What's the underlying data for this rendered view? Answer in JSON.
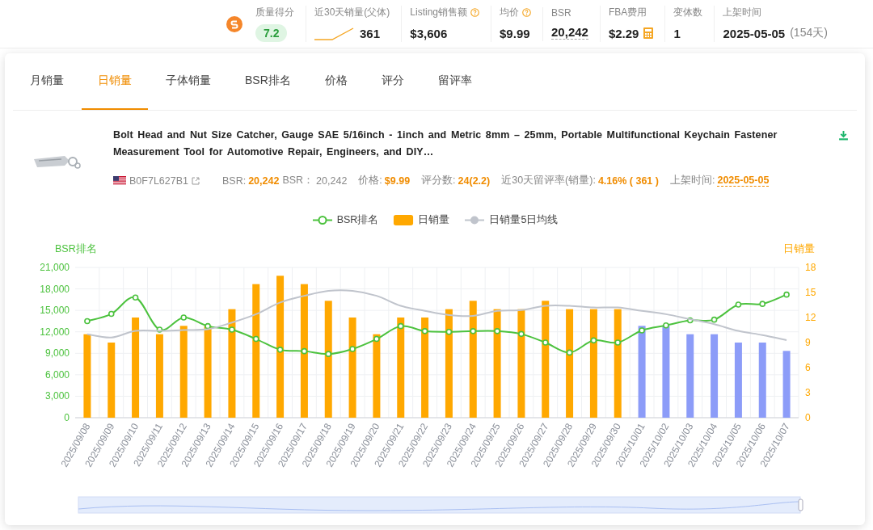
{
  "stats_bar": [
    {
      "kind": "score",
      "label": "质量得分",
      "value": "7.2"
    },
    {
      "kind": "trend",
      "label": "近30天销量(父体)",
      "value": "361"
    },
    {
      "kind": "plain",
      "label": "Listing销售额",
      "value": "$3,606",
      "help": true
    },
    {
      "kind": "plain",
      "label": "均价",
      "value": "$9.99",
      "help": true
    },
    {
      "kind": "underlined",
      "label": "BSR",
      "value": "20,242"
    },
    {
      "kind": "calculator",
      "label": "FBA费用",
      "value": "$2.29"
    },
    {
      "kind": "plain",
      "label": "变体数",
      "value": "1"
    },
    {
      "kind": "date",
      "label": "上架时间",
      "value": "2025-05-05",
      "note": "(154天)"
    }
  ],
  "tabs": [
    {
      "label": "月销量",
      "selected": false
    },
    {
      "label": "日销量",
      "selected": true
    },
    {
      "label": "子体销量",
      "selected": false
    },
    {
      "label": "BSR排名",
      "selected": false
    },
    {
      "label": "价格",
      "selected": false
    },
    {
      "label": "评分",
      "selected": false
    },
    {
      "label": "留评率",
      "selected": false
    }
  ],
  "product": {
    "title": "Bolt Head and Nut Size Catcher, Gauge SAE 5/16inch - 1inch and Metric 8mm – 25mm, Portable Multifunctional Keychain Fastener Measurement Tool for Automotive Repair, Engineers, and DIY…",
    "asin": "B0F7L627B1",
    "facts": [
      {
        "label": "BSR:",
        "value": "20,242",
        "highlighted": true,
        "underlined": false
      },
      {
        "label": "BSR：",
        "value": "20,242",
        "highlighted": false,
        "underlined": false
      },
      {
        "label": "价格:",
        "value": "$9.99",
        "highlighted": true,
        "underlined": false
      },
      {
        "label": "评分数:",
        "value": "24(2.2)",
        "highlighted": true,
        "underlined": false
      },
      {
        "label": "近30天留评率(销量):",
        "value": "4.16% ( 361 )",
        "highlighted": true,
        "underlined": false
      },
      {
        "label": "上架时间:",
        "value": "2025-05-05",
        "highlighted": true,
        "underlined": true
      }
    ]
  },
  "chart_data": {
    "type": "bar",
    "stacked": true,
    "grid": true,
    "ylabel": "BSR排名",
    "y2label": "日销量",
    "ylim": [
      0,
      21000
    ],
    "y2lim": [
      0,
      18
    ],
    "yticks": [
      {
        "value": 0,
        "label": "0"
      },
      {
        "value": 3000,
        "label": "3,000"
      },
      {
        "value": 6000,
        "label": "6,000"
      },
      {
        "value": 9000,
        "label": "9,000"
      },
      {
        "value": 12000,
        "label": "12,000"
      },
      {
        "value": 15000,
        "label": "15,000"
      },
      {
        "value": 18000,
        "label": "18,000"
      },
      {
        "value": 21000,
        "label": "21,000"
      }
    ],
    "y2ticks": [
      0,
      3,
      6,
      9,
      12,
      15,
      18
    ],
    "categories": [
      "2025/09/08",
      "2025/09/09",
      "2025/09/10",
      "2025/09/11",
      "2025/09/12",
      "2025/09/13",
      "2025/09/14",
      "2025/09/15",
      "2025/09/16",
      "2025/09/17",
      "2025/09/18",
      "2025/09/19",
      "2025/09/20",
      "2025/09/21",
      "2025/09/22",
      "2025/09/23",
      "2025/09/24",
      "2025/09/25",
      "2025/09/26",
      "2025/09/27",
      "2025/09/28",
      "2025/09/29",
      "2025/09/30",
      "2025/10/01",
      "2025/10/02",
      "2025/10/03",
      "2025/10/04",
      "2025/10/05",
      "2025/10/06",
      "2025/10/07"
    ],
    "series": [
      {
        "name": "BSR排名",
        "type": "line",
        "marker": "circle",
        "color": "#4cc23e",
        "values": [
          13500,
          14500,
          16800,
          12300,
          14000,
          12800,
          12300,
          11000,
          9500,
          9300,
          8900,
          9600,
          11000,
          12800,
          12100,
          12000,
          12100,
          12100,
          11700,
          10500,
          9100,
          10800,
          10500,
          12200,
          12900,
          13600,
          13700,
          15800,
          15900,
          17200
        ]
      },
      {
        "name": "日销量",
        "type": "bar",
        "axis": "y2",
        "color": "#ffa800",
        "values": [
          10,
          9,
          12,
          10,
          11,
          11,
          13,
          16,
          17,
          16,
          14,
          12,
          10,
          12,
          12,
          13,
          14,
          13,
          13,
          14,
          13,
          13,
          13,
          null,
          null,
          null,
          null,
          null,
          null,
          null
        ]
      },
      {
        "type": "bar",
        "axis": "y2",
        "color": "#8c9cf8",
        "values": [
          null,
          null,
          null,
          null,
          null,
          null,
          null,
          null,
          null,
          null,
          null,
          null,
          null,
          null,
          null,
          null,
          null,
          null,
          null,
          null,
          null,
          null,
          null,
          11,
          11,
          10,
          10,
          9,
          9,
          8
        ]
      },
      {
        "name": "日销量5日均线",
        "type": "line",
        "axis": "y2",
        "color": "#c0c4cc",
        "values": [
          10,
          9.6,
          10.4,
          10.4,
          10.5,
          10.6,
          11.4,
          12.4,
          13.8,
          14.6,
          15.2,
          15.2,
          14.6,
          13.4,
          12.8,
          12.3,
          12.2,
          12.8,
          12.9,
          13.4,
          13.4,
          13.2,
          13.2,
          12.8,
          12.4,
          11.8,
          11.2,
          10.4,
          9.9,
          9.3
        ]
      }
    ]
  }
}
